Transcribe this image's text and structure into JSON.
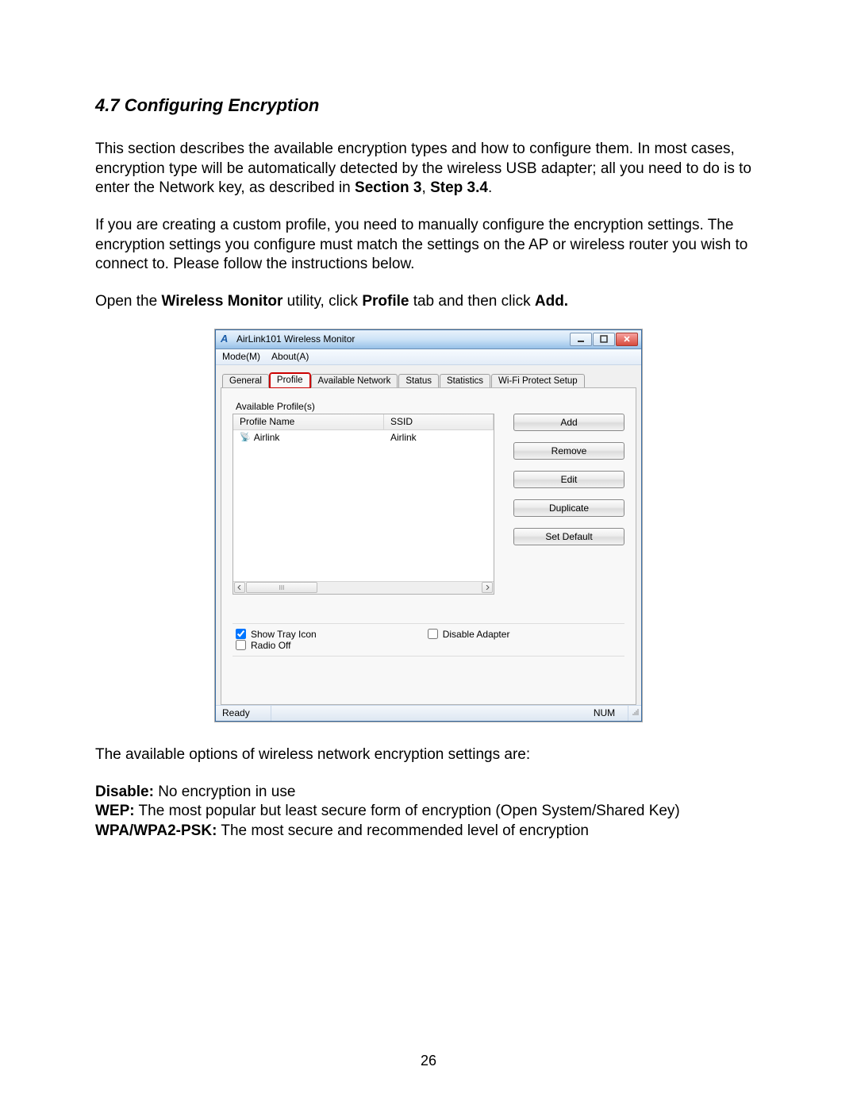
{
  "doc": {
    "heading": "4.7 Configuring Encryption",
    "para1a": "This section describes the available encryption types and how to configure them. In most cases, encryption type will be automatically detected by the wireless USB adapter; all you need to do is to enter the Network key, as described in ",
    "para1_b1": "Section 3",
    "para1_comma": ", ",
    "para1_b2": "Step 3.4",
    "para1_end": ".",
    "para2": "If you are creating a custom profile, you need to manually configure the encryption settings. The encryption settings you configure must match the settings on the AP or wireless router you wish to connect to. Please follow the instructions below.",
    "para3a": "Open the ",
    "para3_b1": "Wireless Monitor",
    "para3b": " utility, click ",
    "para3_b2": "Profile",
    "para3c": " tab and then click ",
    "para3_b3": "Add.",
    "para4": "The available options of wireless network encryption settings are:",
    "opt1_b": "Disable:",
    "opt1_t": "  No encryption in use",
    "opt2_b": "WEP:",
    "opt2_t": "  The most popular but least secure form of encryption (Open System/Shared Key)",
    "opt3_b": "WPA/WPA2-PSK:",
    "opt3_t": "  The most secure and recommended level of encryption",
    "page_number": "26"
  },
  "app": {
    "icon_letter": "A",
    "title": "AirLink101 Wireless Monitor",
    "menu": {
      "mode": "Mode(M)",
      "about": "About(A)"
    },
    "tabs": {
      "general": "General",
      "profile": "Profile",
      "available_network": "Available Network",
      "status": "Status",
      "statistics": "Statistics",
      "wifi_protect": "Wi-Fi Protect Setup"
    },
    "group_label": "Available Profile(s)",
    "columns": {
      "profile_name": "Profile Name",
      "ssid": "SSID"
    },
    "row1": {
      "name": "Airlink",
      "ssid": "Airlink"
    },
    "scroll_marker": "III",
    "buttons": {
      "add": "Add",
      "remove": "Remove",
      "edit": "Edit",
      "duplicate": "Duplicate",
      "set_default": "Set Default"
    },
    "checks": {
      "show_tray": "Show Tray Icon",
      "radio_off": "Radio Off",
      "disable_adapter": "Disable Adapter"
    },
    "status": {
      "ready": "Ready",
      "num": "NUM"
    }
  }
}
